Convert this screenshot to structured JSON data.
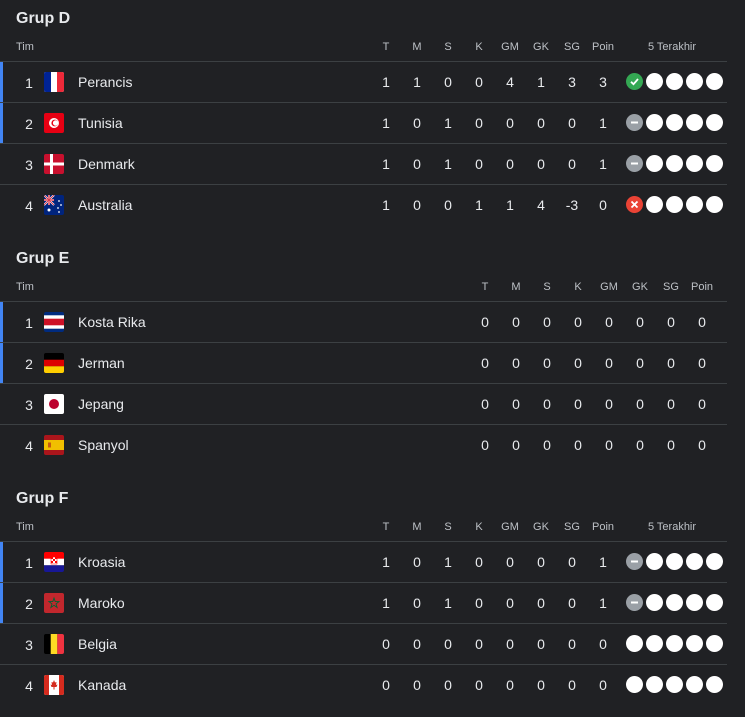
{
  "groups": [
    {
      "title": "Grup D",
      "show_form": true,
      "headers": {
        "team": "Tim",
        "t": "T",
        "m": "M",
        "s": "S",
        "k": "K",
        "gm": "GM",
        "gk": "GK",
        "sg": "SG",
        "poin": "Poin",
        "form": "5 Terakhir"
      },
      "rows": [
        {
          "pos": "1",
          "team": "Perancis",
          "flag": "france",
          "t": "1",
          "m": "1",
          "s": "0",
          "k": "0",
          "gm": "4",
          "gk": "1",
          "sg": "3",
          "poin": "3",
          "form": [
            "win",
            "none",
            "none",
            "none",
            "none"
          ],
          "highlight": true
        },
        {
          "pos": "2",
          "team": "Tunisia",
          "flag": "tunisia",
          "t": "1",
          "m": "0",
          "s": "1",
          "k": "0",
          "gm": "0",
          "gk": "0",
          "sg": "0",
          "poin": "1",
          "form": [
            "draw",
            "none",
            "none",
            "none",
            "none"
          ],
          "highlight": true
        },
        {
          "pos": "3",
          "team": "Denmark",
          "flag": "denmark",
          "t": "1",
          "m": "0",
          "s": "1",
          "k": "0",
          "gm": "0",
          "gk": "0",
          "sg": "0",
          "poin": "1",
          "form": [
            "draw",
            "none",
            "none",
            "none",
            "none"
          ],
          "highlight": false
        },
        {
          "pos": "4",
          "team": "Australia",
          "flag": "australia",
          "t": "1",
          "m": "0",
          "s": "0",
          "k": "1",
          "gm": "1",
          "gk": "4",
          "sg": "-3",
          "poin": "0",
          "form": [
            "loss",
            "none",
            "none",
            "none",
            "none"
          ],
          "highlight": false
        }
      ]
    },
    {
      "title": "Grup E",
      "show_form": false,
      "headers": {
        "team": "Tim",
        "t": "T",
        "m": "M",
        "s": "S",
        "k": "K",
        "gm": "GM",
        "gk": "GK",
        "sg": "SG",
        "poin": "Poin"
      },
      "rows": [
        {
          "pos": "1",
          "team": "Kosta Rika",
          "flag": "costarica",
          "t": "0",
          "m": "0",
          "s": "0",
          "k": "0",
          "gm": "0",
          "gk": "0",
          "sg": "0",
          "poin": "0",
          "highlight": true
        },
        {
          "pos": "2",
          "team": "Jerman",
          "flag": "germany",
          "t": "0",
          "m": "0",
          "s": "0",
          "k": "0",
          "gm": "0",
          "gk": "0",
          "sg": "0",
          "poin": "0",
          "highlight": true
        },
        {
          "pos": "3",
          "team": "Jepang",
          "flag": "japan",
          "t": "0",
          "m": "0",
          "s": "0",
          "k": "0",
          "gm": "0",
          "gk": "0",
          "sg": "0",
          "poin": "0",
          "highlight": false
        },
        {
          "pos": "4",
          "team": "Spanyol",
          "flag": "spain",
          "t": "0",
          "m": "0",
          "s": "0",
          "k": "0",
          "gm": "0",
          "gk": "0",
          "sg": "0",
          "poin": "0",
          "highlight": false
        }
      ]
    },
    {
      "title": "Grup F",
      "show_form": true,
      "headers": {
        "team": "Tim",
        "t": "T",
        "m": "M",
        "s": "S",
        "k": "K",
        "gm": "GM",
        "gk": "GK",
        "sg": "SG",
        "poin": "Poin",
        "form": "5 Terakhir"
      },
      "rows": [
        {
          "pos": "1",
          "team": "Kroasia",
          "flag": "croatia",
          "t": "1",
          "m": "0",
          "s": "1",
          "k": "0",
          "gm": "0",
          "gk": "0",
          "sg": "0",
          "poin": "1",
          "form": [
            "draw",
            "none",
            "none",
            "none",
            "none"
          ],
          "highlight": true
        },
        {
          "pos": "2",
          "team": "Maroko",
          "flag": "morocco",
          "t": "1",
          "m": "0",
          "s": "1",
          "k": "0",
          "gm": "0",
          "gk": "0",
          "sg": "0",
          "poin": "1",
          "form": [
            "draw",
            "none",
            "none",
            "none",
            "none"
          ],
          "highlight": true
        },
        {
          "pos": "3",
          "team": "Belgia",
          "flag": "belgium",
          "t": "0",
          "m": "0",
          "s": "0",
          "k": "0",
          "gm": "0",
          "gk": "0",
          "sg": "0",
          "poin": "0",
          "form": [
            "none",
            "none",
            "none",
            "none",
            "none"
          ],
          "highlight": false
        },
        {
          "pos": "4",
          "team": "Kanada",
          "flag": "canada",
          "t": "0",
          "m": "0",
          "s": "0",
          "k": "0",
          "gm": "0",
          "gk": "0",
          "sg": "0",
          "poin": "0",
          "form": [
            "none",
            "none",
            "none",
            "none",
            "none"
          ],
          "highlight": false
        }
      ]
    }
  ],
  "colors": {
    "background": "#202124",
    "highlight": "#4285f4",
    "win": "#34a853",
    "draw": "#9aa0a6",
    "loss": "#ea4335"
  }
}
